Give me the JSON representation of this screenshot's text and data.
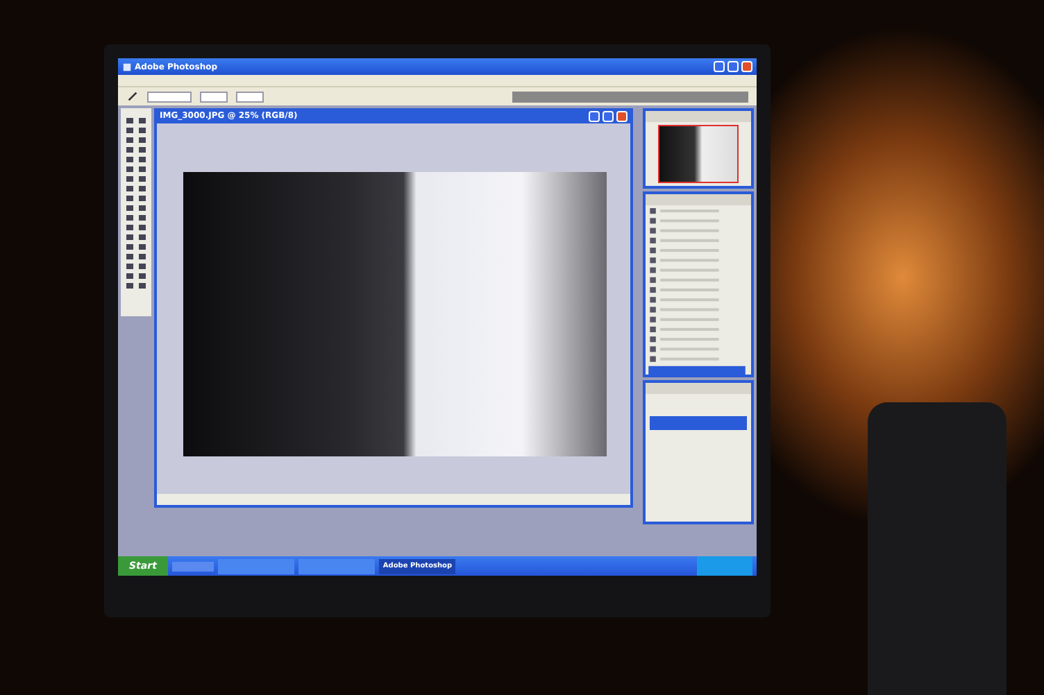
{
  "window": {
    "title": "Adobe Photoshop"
  },
  "document": {
    "title": "IMG_3000.JPG @ 25% (RGB/8)"
  },
  "taskbar": {
    "start": "Start",
    "items": [
      {
        "label": "Adobe Photoshop",
        "selected": true
      }
    ]
  }
}
